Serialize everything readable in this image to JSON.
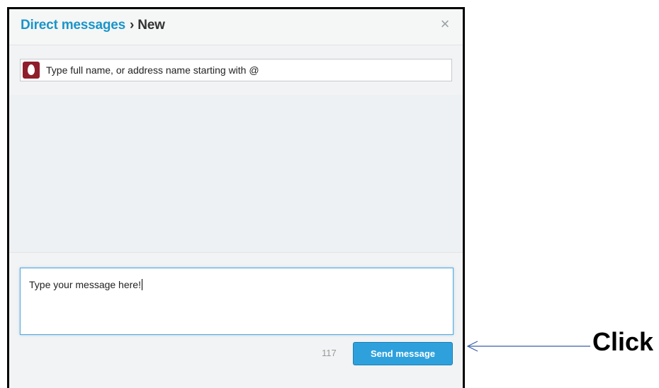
{
  "header": {
    "breadcrumb_link": "Direct messages",
    "breadcrumb_separator": "›",
    "breadcrumb_current": "New",
    "close_symbol": "×"
  },
  "recipient": {
    "avatar_icon": "egg-avatar-icon",
    "placeholder": "Type full name, or address name starting with @"
  },
  "compose": {
    "message_text": "Type your message here!",
    "char_count": "117",
    "send_label": "Send message"
  },
  "annotation": {
    "label": "Click"
  },
  "colors": {
    "link_blue": "#1b95c8",
    "send_button_blue": "#2ea1dd",
    "avatar_red": "#8f1e2c",
    "annotation_line": "#3a5fa8"
  }
}
